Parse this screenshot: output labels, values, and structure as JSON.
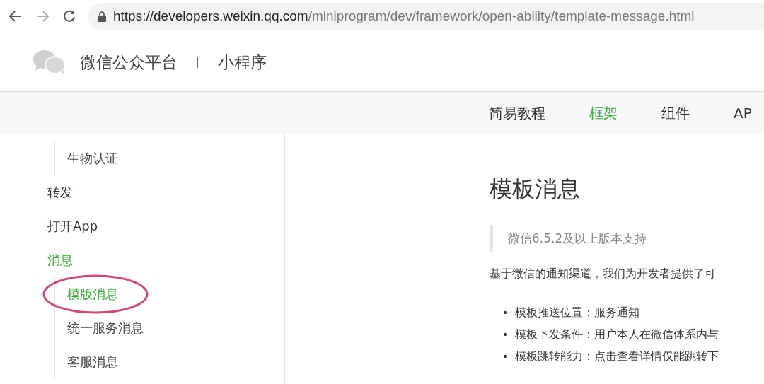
{
  "browser": {
    "url": {
      "host": "https://developers.weixin.qq.com",
      "path": "/miniprogram/dev/framework/open-ability/template-message.html"
    }
  },
  "header": {
    "brand": "微信公众平台",
    "product": "小程序"
  },
  "nav": [
    {
      "label": "简易教程",
      "selected": false
    },
    {
      "label": "框架",
      "selected": true
    },
    {
      "label": "组件",
      "selected": false
    },
    {
      "label": "AP",
      "selected": false
    }
  ],
  "sidebar": {
    "continued_children": [
      {
        "label": "生物认证",
        "selected": false,
        "circled": false
      }
    ],
    "items": [
      {
        "label": "转发",
        "selected": false
      },
      {
        "label": "打开App",
        "selected": false
      },
      {
        "label": "消息",
        "selected": true,
        "children": [
          {
            "label": "模版消息",
            "selected": true,
            "circled": true
          },
          {
            "label": "统一服务消息",
            "selected": false,
            "circled": false
          },
          {
            "label": "客服消息",
            "selected": false,
            "circled": false
          }
        ]
      }
    ]
  },
  "article": {
    "title": "模板消息",
    "note": "微信6.5.2及以上版本支持",
    "intro": "基于微信的通知渠道，我们为开发者提供了可",
    "bullets": [
      {
        "marker": "•",
        "text": "模板推送位置：服务通知"
      },
      {
        "marker": "•",
        "text": "模板下发条件：用户本人在微信体系内与"
      },
      {
        "marker": "•",
        "text": "模板跳转能力：点击查看详情仅能跳转下"
      }
    ]
  }
}
